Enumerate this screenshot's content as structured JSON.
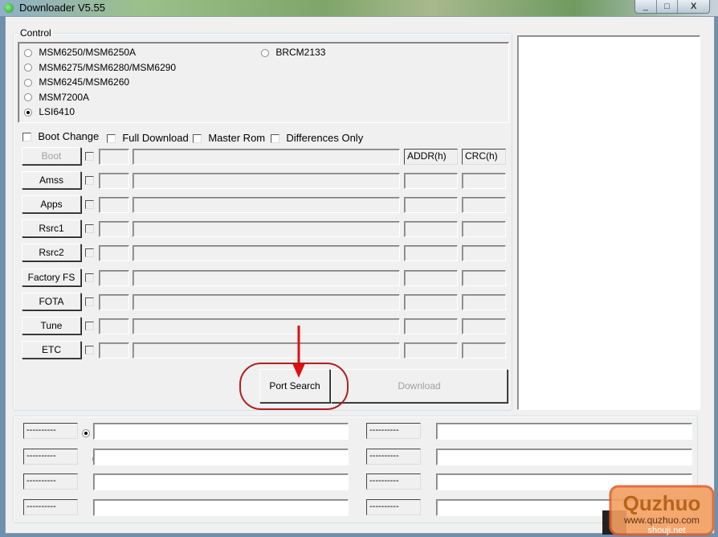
{
  "window": {
    "title": "Downloader V5.55",
    "minimize": "_",
    "maximize": "□",
    "close": "X"
  },
  "control": {
    "legend": "Control",
    "chipsets": [
      {
        "label": "MSM6250/MSM6250A",
        "selected": false
      },
      {
        "label": "MSM6275/MSM6280/MSM6290",
        "selected": false
      },
      {
        "label": "MSM6245/MSM6260",
        "selected": false
      },
      {
        "label": "MSM7200A",
        "selected": false
      },
      {
        "label": "LSI6410",
        "selected": true
      },
      {
        "label": "BRCM2133",
        "selected": false
      }
    ],
    "options": [
      {
        "label": "Boot Change",
        "checked": false
      },
      {
        "label": "Full Download",
        "checked": false
      },
      {
        "label": "Master Rom",
        "checked": false
      },
      {
        "label": "Differences Only",
        "checked": false
      }
    ],
    "columns": {
      "addr": "ADDR(h)",
      "crc": "CRC(h)"
    },
    "files": [
      {
        "label": "Boot",
        "enabled": false
      },
      {
        "label": "Amss",
        "enabled": true
      },
      {
        "label": "Apps",
        "enabled": true
      },
      {
        "label": "Rsrc1",
        "enabled": true
      },
      {
        "label": "Rsrc2",
        "enabled": true
      },
      {
        "label": "Factory FS",
        "enabled": true
      },
      {
        "label": "FOTA",
        "enabled": true
      },
      {
        "label": "Tune",
        "enabled": true
      },
      {
        "label": "ETC",
        "enabled": true
      }
    ],
    "port_search": "Port Search",
    "download": "Download"
  },
  "ports": [
    {
      "label": "----------",
      "selected": true,
      "value": ""
    },
    {
      "label": "----------",
      "selected": false,
      "value": ""
    },
    {
      "label": "----------",
      "selected": false,
      "value": ""
    },
    {
      "label": "----------",
      "selected": false,
      "value": ""
    },
    {
      "label": "----------",
      "selected": false,
      "value": ""
    },
    {
      "label": "----------",
      "selected": false,
      "value": ""
    },
    {
      "label": "----------",
      "selected": false,
      "value": ""
    },
    {
      "label": "----------",
      "selected": false,
      "value": ""
    }
  ],
  "annotation": {
    "color": "#e01010"
  },
  "watermark": {
    "brand": "Quzhuo",
    "url": "www.quzhuo.com",
    "sub": "shouji.net"
  }
}
